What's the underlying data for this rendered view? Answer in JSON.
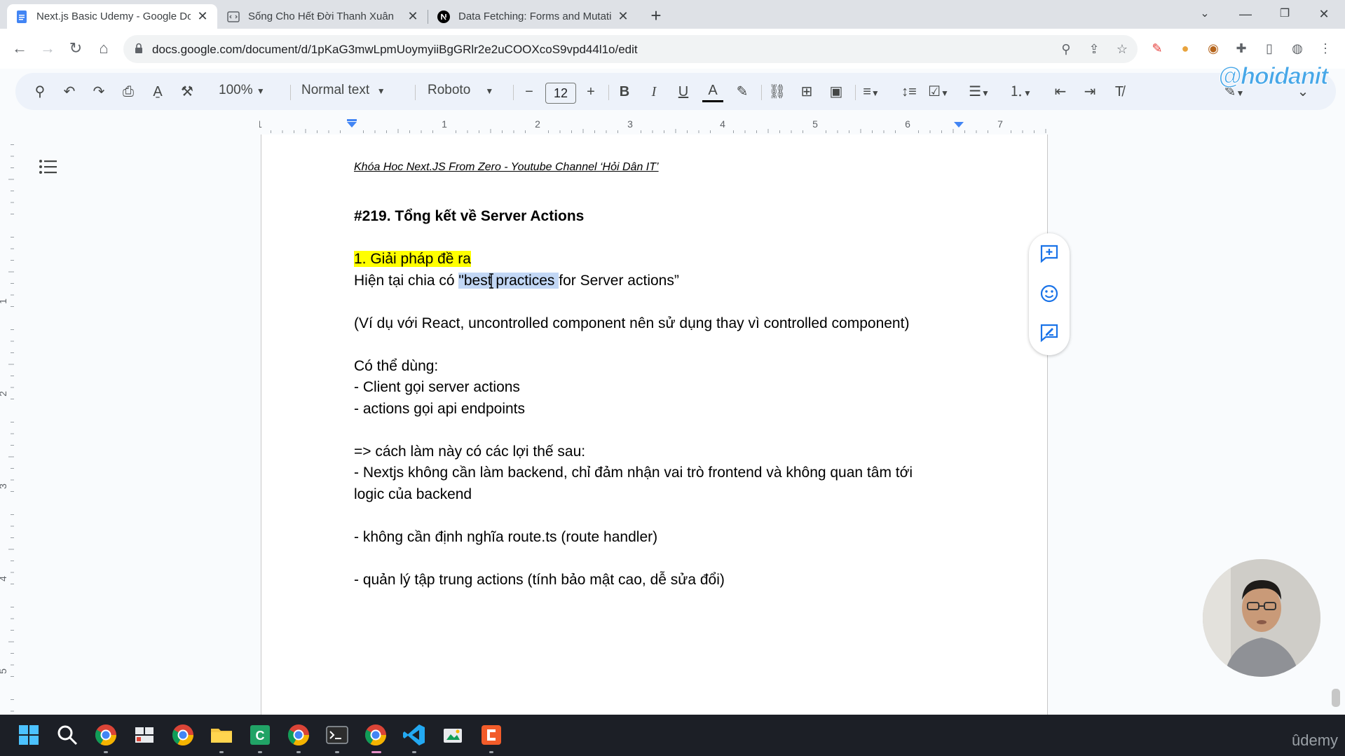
{
  "tabs": [
    {
      "title": "Next.js Basic Udemy - Google Docs",
      "icon": "google-docs-icon",
      "active": true
    },
    {
      "title": "Sống Cho Hết Đời Thanh Xuân",
      "icon": "web-page-icon",
      "active": false
    },
    {
      "title": "Data Fetching: Forms and Mutations",
      "icon": "nextjs-icon",
      "active": false
    }
  ],
  "address_bar": {
    "url": "docs.google.com/document/d/1pKaG3mwLpmUoymyiiBgGRlr2e2uCOOXcoS9vpd44l1o/edit"
  },
  "toolbar": {
    "zoom": "100%",
    "style": "Normal text",
    "font": "Roboto",
    "font_size": "12"
  },
  "watermark": "@hoidanit",
  "ruler": {
    "horizontal_numbers": [
      "1",
      "1",
      "2",
      "3",
      "4",
      "5",
      "6",
      "7"
    ],
    "vertical_numbers": [
      "1",
      "2",
      "3",
      "4",
      "5"
    ]
  },
  "document": {
    "header": "Khóa Hoc Next.JS From Zero - Youtube Channel ‘Hỏi Dân IT’",
    "title": "#219. Tổng kết về Server Actions",
    "section1_heading": "1. Giải pháp đề ra",
    "line_current_prefix": "Hiện tại chia có ",
    "line_current_selected": "\"best practices ",
    "line_current_suffix": "for Server actions”",
    "line_example": "(Ví dụ với React, uncontrolled component nên sử dụng thay vì controlled component)",
    "line_can_use": "Có thể dùng:",
    "line_client": "- Client gọi server actions",
    "line_actions": "- actions gọi api endpoints",
    "line_benefits": "=> cách làm này có các lợi thế sau:",
    "line_nextjs_1": "- Nextjs không cần làm backend, chỉ đảm nhận vai trò frontend và không quan tâm tới",
    "line_nextjs_2": "logic của backend",
    "line_route": "- không cần định nghĩa route.ts (route handler)",
    "line_manage": "- quản lý tập trung actions (tính bảo mật cao, dễ sửa đổi)"
  },
  "side_actions": [
    "add-comment-icon",
    "emoji-reaction-icon",
    "suggest-edits-icon"
  ],
  "taskbar_icons": [
    "windows-start-icon",
    "search-icon",
    "chrome-icon",
    "app-icon",
    "chrome-icon",
    "file-explorer-icon",
    "app-green-icon",
    "chrome-icon",
    "terminal-icon",
    "chrome-icon",
    "vscode-icon",
    "app-icon",
    "app-orange-icon"
  ],
  "brand": "ûdemy"
}
